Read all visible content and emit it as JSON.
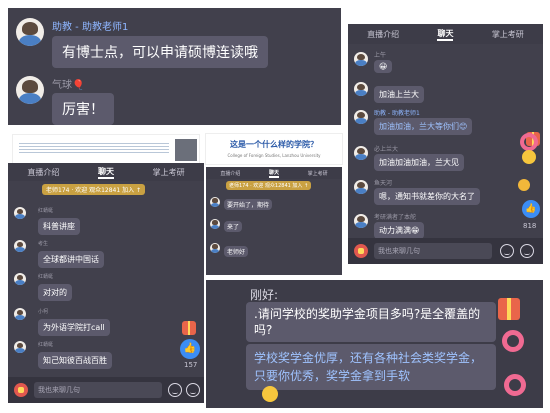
{
  "top_left": {
    "msg1_name": "助教 - 助教老师1",
    "msg1_text": "有博士点，可以申请硕博连读哦",
    "msg2_name": "气球🎈",
    "msg2_text": "厉害！"
  },
  "tabs": {
    "t1": "直播介绍",
    "t2": "聊天",
    "t3": "掌上考研"
  },
  "right_top": {
    "items": [
      {
        "name": "上午",
        "text": "😀"
      },
      {
        "name": "",
        "text": "加油上兰大"
      },
      {
        "name": "助教 - 助教老师1",
        "text": "加油加油，兰大等你们😊"
      },
      {
        "name": "必上兰大",
        "text": "加油加油加油，兰大见"
      },
      {
        "name": "鱼天河",
        "text": "嗯，通知书就差你的大名了"
      },
      {
        "name": "考研满者了本舵",
        "text": "动力满满😁"
      }
    ],
    "input": "我也来聊几句",
    "like_count": "818"
  },
  "mid_left": {
    "notice": "老师174 · 欢迎 观众12841 加入 ↑",
    "items": [
      {
        "name": "红蜻蜓",
        "text": "科普讲座"
      },
      {
        "name": "考生",
        "text": "全球都讲中国话"
      },
      {
        "name": "红蜻蜓",
        "text": "对对的"
      },
      {
        "name": "小柯",
        "text": "为外语学院打call"
      },
      {
        "name": "红蜻蜓",
        "text": "知己知彼百战百胜"
      }
    ],
    "input": "我也来聊几句",
    "like_count": "157"
  },
  "mid_center": {
    "title": "这是一个什么样的学院？",
    "subtitle": "College of Foreign Studies, Lanzhou University",
    "notice": "老师174 · 欢迎 观众12841 加入 ↑",
    "items": [
      {
        "name": "",
        "text": "要开始了，期待"
      },
      {
        "name": "",
        "text": "来了"
      },
      {
        "name": "",
        "text": "老师好"
      }
    ]
  },
  "bottom_right": {
    "name": "刚好:",
    "question": ".请问学校的奖助学金项目多吗?是全覆盖的吗?",
    "answer": "学校奖学金优厚，还有各种社会类奖学金，只要你优秀，奖学金拿到手软"
  },
  "colors": {
    "panel": "#41404c",
    "bubble": "#5c5a6c",
    "accent_blue": "#3b8df5",
    "gold": "#c9a142"
  }
}
